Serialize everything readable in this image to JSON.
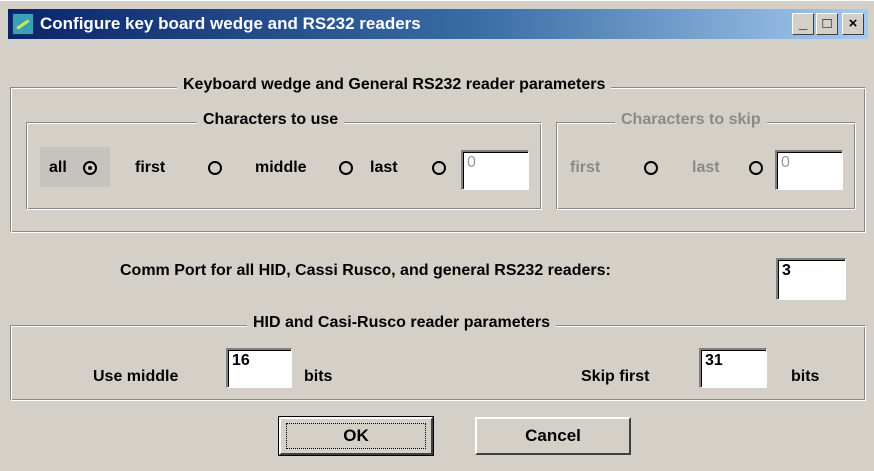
{
  "window": {
    "title": "Configure key board wedge and RS232 readers"
  },
  "titlebar": {
    "minimize": "_",
    "maximize": "□",
    "close": "×"
  },
  "wedge_group": {
    "label": "Keyboard wedge and General RS232 reader parameters"
  },
  "chars_use": {
    "label": "Characters to use",
    "options": [
      "all",
      "first",
      "middle",
      "last"
    ],
    "selected": "all",
    "count_value": "0"
  },
  "chars_skip": {
    "label": "Characters to skip",
    "options": [
      "first",
      "last"
    ],
    "count_value": "0"
  },
  "comm_port": {
    "label": "Comm Port for all HID, Cassi Rusco, and general RS232 readers:",
    "value": "3"
  },
  "hid_group": {
    "label": "HID and Casi-Rusco reader parameters",
    "use_middle_label": "Use middle",
    "use_middle_value": "16",
    "use_middle_unit": "bits",
    "skip_first_label": "Skip first",
    "skip_first_value": "31",
    "skip_first_unit": "bits"
  },
  "buttons": {
    "ok": "OK",
    "cancel": "Cancel"
  },
  "colors": {
    "titlebar_start": "#0a246a",
    "titlebar_end": "#a6caf0",
    "face": "#d4d0c8"
  }
}
